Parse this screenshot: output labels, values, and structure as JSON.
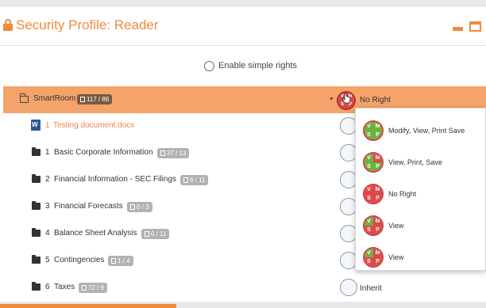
{
  "header": {
    "title": "Security Profile: Reader",
    "icons": [
      "lock-icon",
      "minimize-icon",
      "maximize-icon"
    ]
  },
  "simple_rights": {
    "label": "Enable simple rights",
    "checked": false
  },
  "root": {
    "label": "SmartRoom",
    "badge": "117 / 86",
    "status_label": "No Right",
    "icons": [
      "folder-open-icon",
      "doc-icon",
      "folder-icon",
      "caret-down-icon"
    ]
  },
  "rows": [
    {
      "num": "1",
      "label": "Testing document.docx",
      "badge": "",
      "status": "",
      "type": "document"
    },
    {
      "num": "1",
      "label": "Basic Corporate Information",
      "badge": "37 / 13",
      "status": "",
      "type": "folder"
    },
    {
      "num": "2",
      "label": "Financial Information - SEC Filings",
      "badge": "6 / 11",
      "status": "",
      "type": "folder"
    },
    {
      "num": "3",
      "label": "Financial Forecasts",
      "badge": "0 / 3",
      "status": "",
      "type": "folder"
    },
    {
      "num": "4",
      "label": "Balance Sheet Analysis",
      "badge": "0 / 11",
      "status": "",
      "type": "folder"
    },
    {
      "num": "5",
      "label": "Contingencies",
      "badge": "1 / 4",
      "status": "",
      "type": "folder"
    },
    {
      "num": "6",
      "label": "Taxes",
      "badge": "72 / 9",
      "status": "Inherit",
      "type": "folder"
    }
  ],
  "dropdown": {
    "options": [
      {
        "label": "Modify, View, Print Save",
        "v": "#6cb33e",
        "m": "#6cb33e",
        "s": "#6cb33e",
        "p": "#6cb33e"
      },
      {
        "label": "View, Print, Save",
        "v": "#6cb33e",
        "m": "#e04848",
        "s": "#6cb33e",
        "p": "#6cb33e"
      },
      {
        "label": "No Right",
        "v": "#e04848",
        "m": "#e04848",
        "s": "#e04848",
        "p": "#e04848"
      },
      {
        "label": "View",
        "v": "#6cb33e",
        "m": "#e04848",
        "s": "#e04848",
        "p": "#e04848"
      },
      {
        "label": "View",
        "v": "#6cb33e",
        "m": "#e04848",
        "s": "#e04848",
        "p": "#e04848"
      }
    ]
  },
  "vms_letters": {
    "v": "V",
    "m": "M",
    "s": "S",
    "p": "P"
  },
  "colors": {
    "accent": "#f08a3c",
    "root_row": "#f4a36a",
    "granted": "#6cb33e",
    "denied": "#e04848"
  }
}
